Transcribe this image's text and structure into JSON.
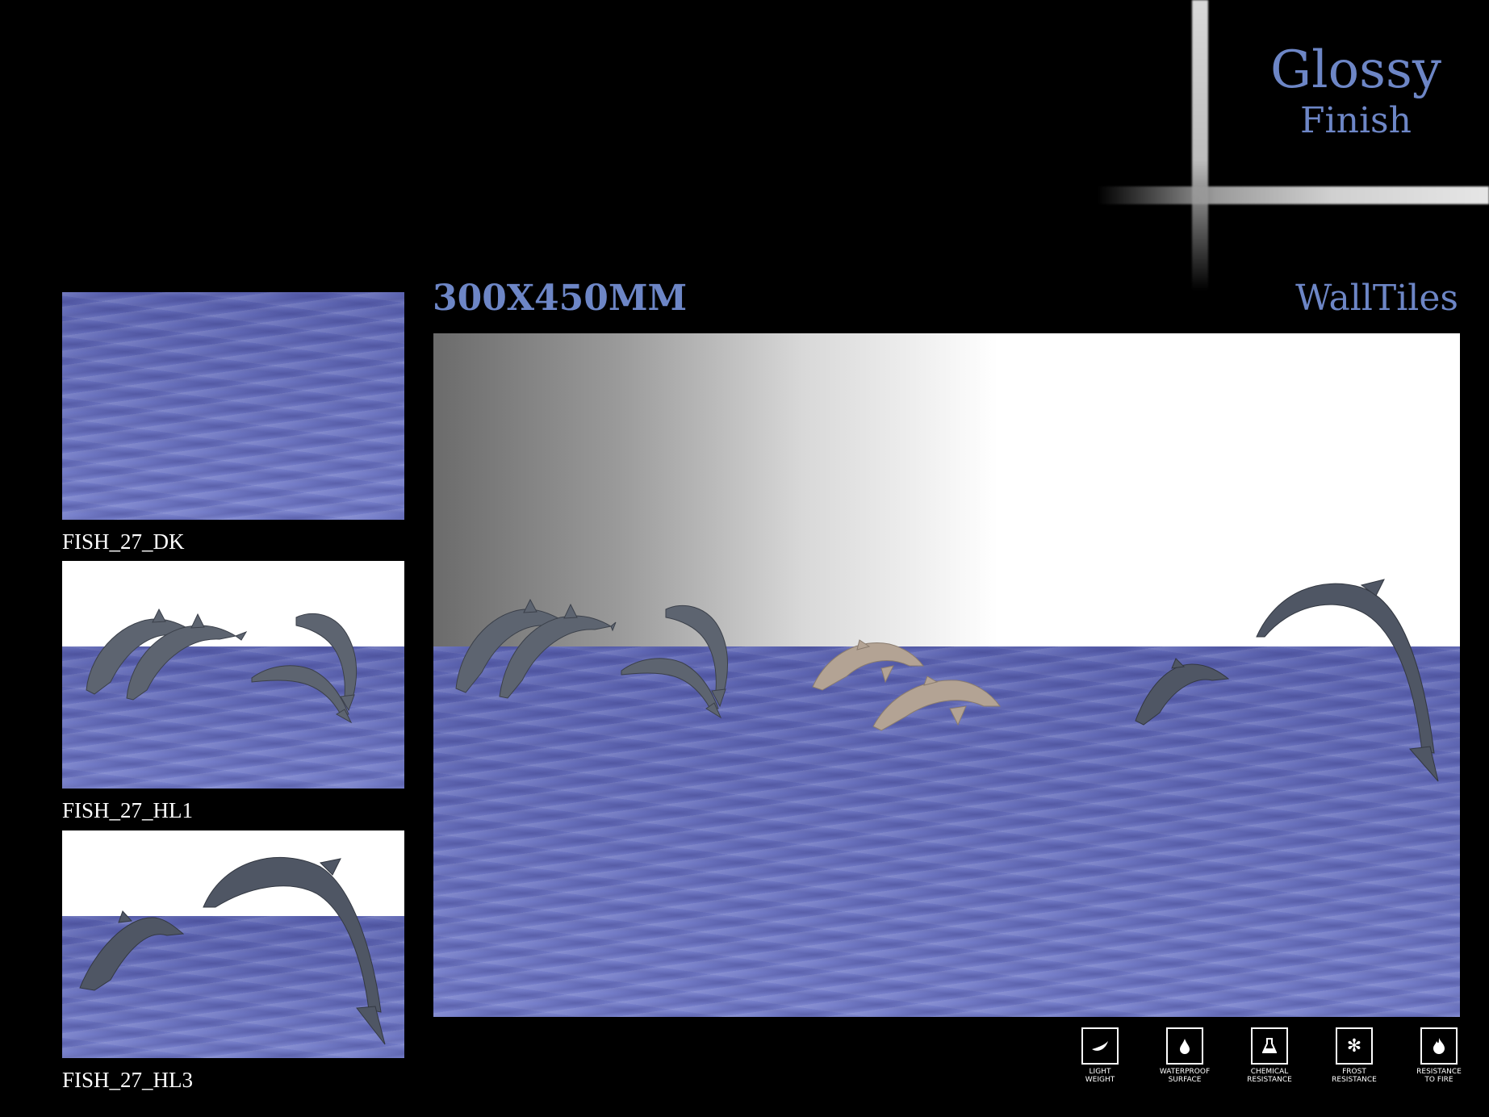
{
  "brand": {
    "title": "Glossy",
    "subtitle": "Finish"
  },
  "tile_size": "300X450MM",
  "category": "WallTiles",
  "thumbnails": [
    {
      "code": "FISH_27_DK"
    },
    {
      "code": "FISH_27_HL1"
    },
    {
      "code": "FISH_27_HL3"
    }
  ],
  "features": [
    {
      "icon": "feather-icon",
      "label": "LIGHT\nWEIGHT"
    },
    {
      "icon": "water-drop-icon",
      "label": "WATERPROOF\nSURFACE"
    },
    {
      "icon": "flask-icon",
      "label": "CHEMICAL\nRESISTANCE"
    },
    {
      "icon": "snowflake-icon",
      "label": "FROST\nRESISTANCE"
    },
    {
      "icon": "flame-icon",
      "label": "RESISTANCE\nTO FIRE"
    }
  ],
  "colors": {
    "accent": "#6d86c6",
    "water": "#6b74c2",
    "background": "#000000"
  }
}
